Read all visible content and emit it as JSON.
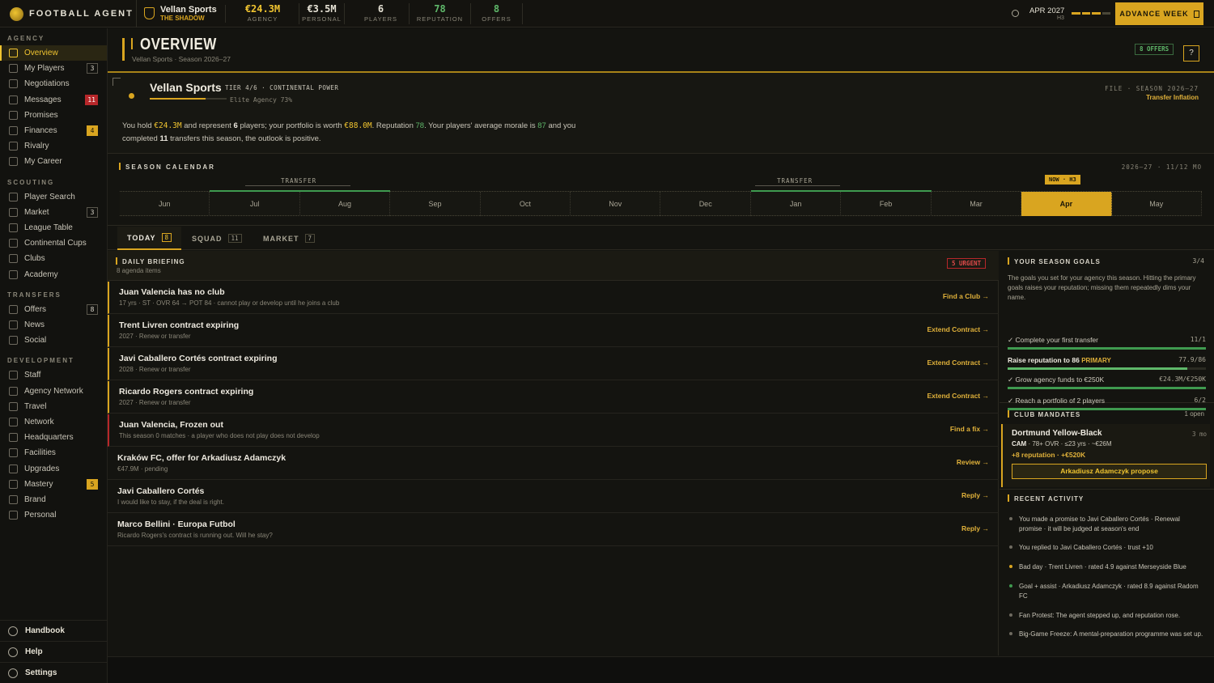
{
  "app": {
    "name": "FOOTBALL AGENT"
  },
  "agency": {
    "name": "Vellan Sports",
    "subtitle": "THE SHADOW"
  },
  "stats": [
    {
      "value": "€24.3M",
      "label": "AGENCY",
      "color": "#f0c430"
    },
    {
      "value": "€3.5M",
      "label": "PERSONAL",
      "color": "#e5e1d4"
    },
    {
      "value": "6",
      "label": "PLAYERS",
      "color": "#e5e1d4"
    },
    {
      "value": "78",
      "label": "REPUTATION",
      "color": "#5fb86a"
    },
    {
      "value": "8",
      "label": "OFFERS",
      "color": "#5fb86a"
    }
  ],
  "date": {
    "main": "APR 2027",
    "sub": "H3"
  },
  "advance_label": "ADVANCE WEEK",
  "sidebar": {
    "sections": [
      {
        "label": "AGENCY",
        "items": [
          {
            "label": "Overview",
            "icon": "grid-icon",
            "active": true
          },
          {
            "label": "My Players",
            "icon": "user-icon",
            "badge": "3"
          },
          {
            "label": "Negotiations",
            "icon": "chat-icon"
          },
          {
            "label": "Messages",
            "icon": "mail-icon",
            "badge": "11",
            "badge_style": "red"
          },
          {
            "label": "Promises",
            "icon": "link-icon"
          },
          {
            "label": "Finances",
            "icon": "euro-icon",
            "badge": "4",
            "badge_style": "gold"
          },
          {
            "label": "Rivalry",
            "icon": "swords-icon"
          },
          {
            "label": "My Career",
            "icon": "medal-icon"
          }
        ]
      },
      {
        "label": "SCOUTING",
        "items": [
          {
            "label": "Player Search",
            "icon": "search-icon"
          },
          {
            "label": "Market",
            "icon": "bar-chart-icon",
            "badge": "3"
          },
          {
            "label": "League Table",
            "icon": "table-icon"
          },
          {
            "label": "Continental Cups",
            "icon": "trophy-icon"
          },
          {
            "label": "Clubs",
            "icon": "shield-icon"
          },
          {
            "label": "Academy",
            "icon": "graduation-icon"
          }
        ]
      },
      {
        "label": "TRANSFERS",
        "items": [
          {
            "label": "Offers",
            "icon": "swap-icon",
            "badge": "8"
          },
          {
            "label": "News",
            "icon": "globe-icon"
          },
          {
            "label": "Social",
            "icon": "broadcast-icon"
          }
        ]
      },
      {
        "label": "DEVELOPMENT",
        "items": [
          {
            "label": "Staff",
            "icon": "staff-icon"
          },
          {
            "label": "Agency Network",
            "icon": "network-icon"
          },
          {
            "label": "Travel",
            "icon": "plane-icon"
          },
          {
            "label": "Network",
            "icon": "link-icon"
          },
          {
            "label": "Headquarters",
            "icon": "building-icon"
          },
          {
            "label": "Facilities",
            "icon": "dumbbell-icon"
          },
          {
            "label": "Upgrades",
            "icon": "trend-icon"
          },
          {
            "label": "Mastery",
            "icon": "layers-icon",
            "badge": "5",
            "badge_style": "gold"
          },
          {
            "label": "Brand",
            "icon": "star-icon"
          },
          {
            "label": "Personal",
            "icon": "diamond-icon"
          }
        ]
      }
    ],
    "bottom": [
      {
        "label": "Handbook",
        "icon": "book-icon"
      },
      {
        "label": "Help",
        "icon": "help-icon"
      },
      {
        "label": "Settings",
        "icon": "gear-icon"
      }
    ]
  },
  "page": {
    "title": "OVERVIEW",
    "subtitle": "Vellan Sports · Season 2026–27",
    "offers_badge": "8 OFFERS",
    "help": "?"
  },
  "agency_card": {
    "name": "Vellan Sports",
    "tier": "TIER 4/6 · CONTINENTAL POWER",
    "level": "Elite Agency 73%",
    "level_fraction": 0.73,
    "file": "FILE · SEASON 2026–27",
    "tag": "Transfer Inflation",
    "summary": {
      "p1": "You hold ",
      "funds": "€24.3M",
      "p2": " and represent ",
      "players": "6",
      "p3": " players; your portfolio is worth ",
      "portfolio": "€88.0M",
      "p4": ". Reputation ",
      "rep": "78",
      "p5": ". Your players' average morale is ",
      "morale": "87",
      "p6": " and you",
      "p7": "completed ",
      "transfers": "11",
      "p8": " transfers this season, the outlook is positive."
    }
  },
  "calendar": {
    "title": "SEASON CALENDAR",
    "meta": "2026–27 · 11/12 MO",
    "windows": [
      "TRANSFER",
      "TRANSFER"
    ],
    "now": "NOW · H3",
    "months": [
      "Jun",
      "Jul",
      "Aug",
      "Sep",
      "Oct",
      "Nov",
      "Dec",
      "Jan",
      "Feb",
      "Mar",
      "Apr",
      "May"
    ],
    "current": 10
  },
  "tabs": [
    {
      "label": "TODAY",
      "count": "8",
      "active": true
    },
    {
      "label": "SQUAD",
      "count": "11"
    },
    {
      "label": "MARKET",
      "count": "7"
    }
  ],
  "briefing": {
    "title": "DAILY BRIEFING",
    "sub": "8 agenda items",
    "urgent": "5 URGENT",
    "items": [
      {
        "title": "Juan Valencia has no club",
        "sub": "17 yrs · ST · OVR 64 → POT 84 · cannot play or develop until he joins a club",
        "action": "Find a Club →",
        "accent": "#d9a520"
      },
      {
        "title": "Trent Livren contract expiring",
        "sub": "2027 · Renew or transfer",
        "action": "Extend Contract →",
        "accent": "#d9a520"
      },
      {
        "title": "Javi Caballero Cortés contract expiring",
        "sub": "2028 · Renew or transfer",
        "action": "Extend Contract →",
        "accent": "#d9a520"
      },
      {
        "title": "Ricardo Rogers contract expiring",
        "sub": "2027 · Renew or transfer",
        "action": "Extend Contract →",
        "accent": "#d9a520"
      },
      {
        "title": "Juan Valencia, Frozen out",
        "sub": "This season 0 matches · a player who does not play does not develop",
        "action": "Find a fix →",
        "accent": "#b7272a"
      },
      {
        "title": "Kraków FC, offer for Arkadiusz Adamczyk",
        "sub": "€47.9M · pending",
        "action": "Review →",
        "accent": ""
      },
      {
        "title": "Javi Caballero Cortés",
        "sub": "I would like to stay, if the deal is right.",
        "action": "Reply →",
        "accent": ""
      },
      {
        "title": "Marco Bellini · Europa Futbol",
        "sub": "Ricardo Rogers's contract is running out. Will he stay?",
        "action": "Reply →",
        "accent": ""
      }
    ]
  },
  "goals": {
    "title": "YOUR SEASON GOALS",
    "count": "3/4",
    "desc": "The goals you set for your agency this season. Hitting the primary goals raises your reputation; missing them repeatedly dims your name.",
    "items": [
      {
        "label": "✓ Complete your first transfer",
        "progress": "11/1",
        "fraction": 1.0,
        "done": true
      },
      {
        "label": "Raise reputation to 86",
        "primary": "PRIMARY",
        "progress": "77.9/86",
        "fraction": 0.906,
        "done": false
      },
      {
        "label": "✓ Grow agency funds to €250K",
        "progress": "€24.3M/€250K",
        "fraction": 1.0,
        "done": true
      },
      {
        "label": "✓ Reach a portfolio of 2 players",
        "progress": "6/2",
        "fraction": 1.0,
        "done": true
      }
    ]
  },
  "mandates": {
    "title": "CLUB MANDATES",
    "count": "1 open",
    "club": "Dortmund Yellow-Black",
    "time": "3 mo",
    "pos": "CAM",
    "req": " · 78+ OVR · ≤23 yrs · ~€26M",
    "reward": "+8 reputation · +€520K",
    "button": "Arkadiusz Adamczyk propose"
  },
  "activity": {
    "title": "RECENT ACTIVITY",
    "items": [
      {
        "text": "You made a promise to Javi Caballero Cortés · Renewal promise · it will be judged at season's end",
        "color": "#6f6b60"
      },
      {
        "text": "You replied to Javi Caballero Cortés · trust +10",
        "color": "#6f6b60"
      },
      {
        "text": "Bad day · Trent Livren · rated 4.9 against Merseyside Blue",
        "color": "#d9a520"
      },
      {
        "text": "Goal + assist · Arkadiusz Adamczyk · rated 8.9 against Radom FC",
        "color": "#3f9a4f"
      },
      {
        "text": "Fan Protest: The agent stepped up, and reputation rose.",
        "color": "#6f6b60"
      },
      {
        "text": "Big-Game Freeze: A mental-preparation programme was set up.",
        "color": "#6f6b60"
      }
    ]
  }
}
